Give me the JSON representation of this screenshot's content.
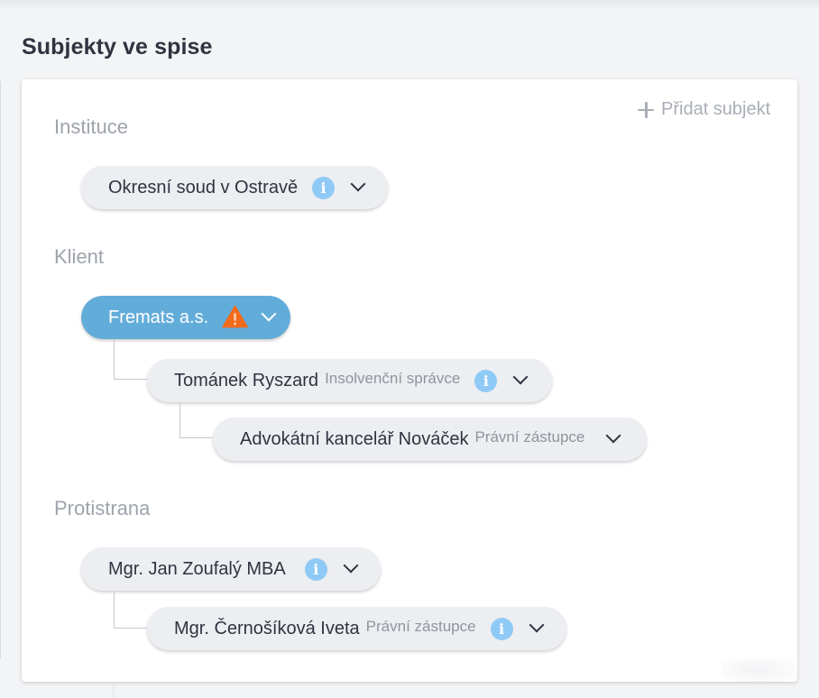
{
  "page": {
    "title": "Subjekty ve spise"
  },
  "toolbar": {
    "add_subject_label": "Přidat subjekt"
  },
  "sections": {
    "instituce": {
      "label": "Instituce",
      "subjects": [
        {
          "name": "Okresní soud v Ostravě",
          "role": "",
          "icon": "info-icon"
        }
      ]
    },
    "klient": {
      "label": "Klient",
      "subjects": [
        {
          "name": "Fremats a.s.",
          "role": "",
          "icon": "warning-icon",
          "highlighted": true
        },
        {
          "name": "Tománek Ryszard",
          "role": "Insolvenční správce",
          "icon": "info-icon"
        },
        {
          "name": "Advokátní kancelář Nováček",
          "role": "Právní zástupce",
          "icon": ""
        }
      ]
    },
    "protistrana": {
      "label": "Protistrana",
      "subjects": [
        {
          "name": "Mgr. Jan Zoufalý MBA",
          "role": "",
          "icon": "info-icon"
        },
        {
          "name": "Mgr. Černošíková Iveta",
          "role": "Právní zástupce",
          "icon": "info-icon"
        }
      ]
    }
  },
  "icons": {
    "info_glyph": "i",
    "add_icon": "plus-icon",
    "expand_icon": "chevron-down-icon"
  },
  "colors": {
    "highlight": "#62acd9",
    "info": "#8fcaf6",
    "warning": "#f26a1b",
    "pill_background": "#eceef1"
  }
}
